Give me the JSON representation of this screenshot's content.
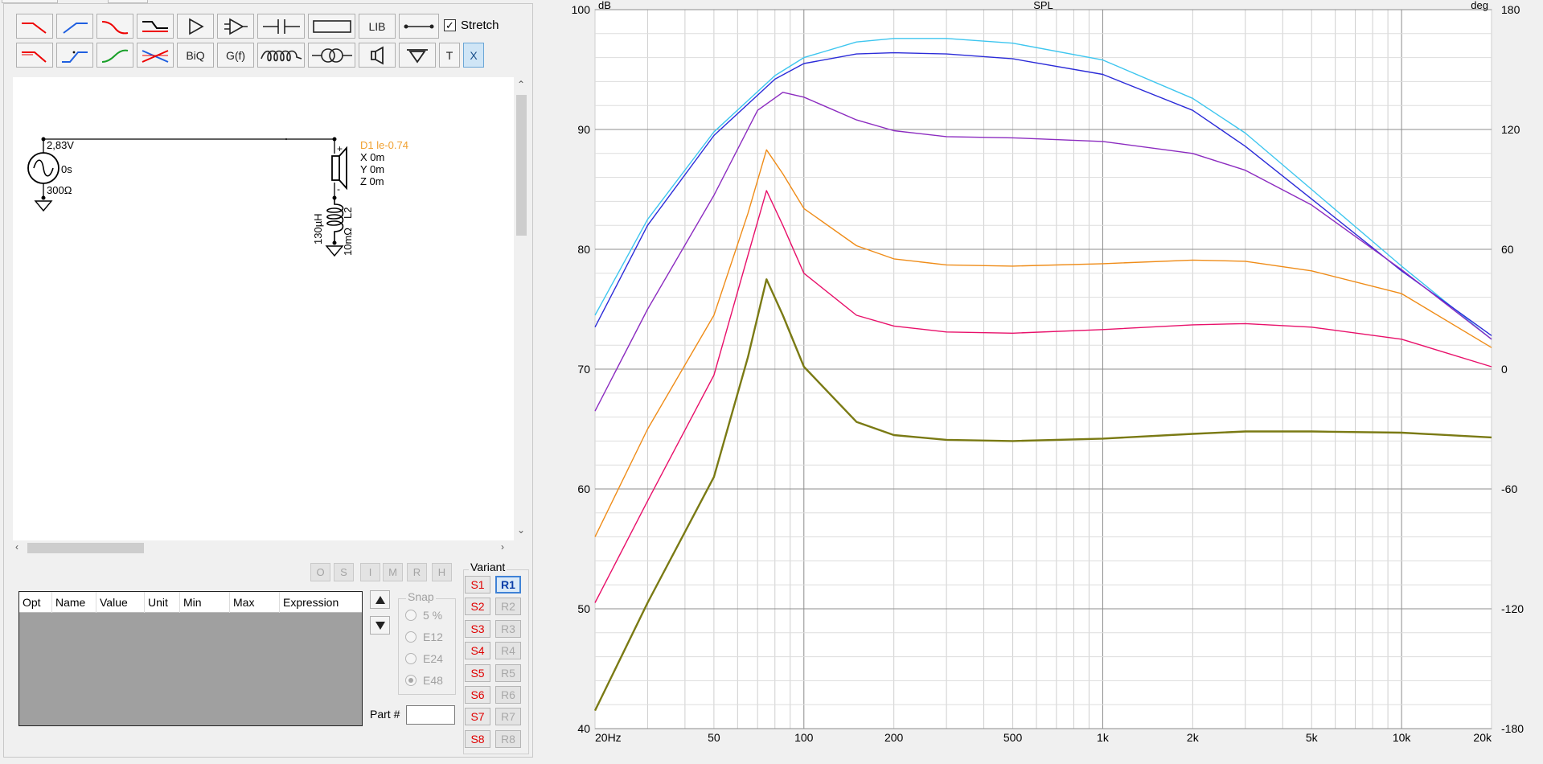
{
  "toolbar": {
    "row1_labels": [
      "LIB"
    ],
    "row2_labels": [
      "BiQ",
      "G(f)",
      "T",
      "X"
    ],
    "stretch_label": "Stretch",
    "stretch_checked": true,
    "icons_row1": [
      "lowpass-filter-icon",
      "highpass-filter-icon",
      "bandpass-filter-icon",
      "shelf-filter-icon",
      "buffer-amp-icon",
      "opamp-icon",
      "capacitor-icon",
      "resistor-icon",
      "lib-button",
      "wire-icon"
    ],
    "icons_row2": [
      "lowpass-2-icon",
      "highpass-2-icon",
      "allpass-icon",
      "crossover-icon",
      "biquad-button",
      "transfer-function-button",
      "inductor-icon",
      "transformer-icon",
      "speaker-icon",
      "ground-icon",
      "text-button",
      "x-button"
    ]
  },
  "schematic": {
    "source_voltage": "2,83V",
    "source_delay": "0s",
    "source_impedance": "300Ω",
    "driver_name": "D1 le-0.74",
    "driver_x": "X 0m",
    "driver_y": "Y 0m",
    "driver_z": "Z 0m",
    "inductor_value": "130µH",
    "inductor_resistance": "10mΩ",
    "inductor_name": "L2",
    "plus": "+",
    "minus": "-"
  },
  "opt_buttons": [
    "O",
    "S",
    "I",
    "M",
    "R",
    "H"
  ],
  "table": {
    "columns": [
      "Opt",
      "Name",
      "Value",
      "Unit",
      "Min",
      "Max",
      "Expression"
    ]
  },
  "snap": {
    "label": "Snap",
    "options": [
      "5 %",
      "E12",
      "E24",
      "E48"
    ],
    "selected": "E48"
  },
  "part_label": "Part #",
  "variant": {
    "label": "Variant",
    "s_buttons": [
      "S1",
      "S2",
      "S3",
      "S4",
      "S5",
      "S6",
      "S7",
      "S8"
    ],
    "r_buttons": [
      "R1",
      "R2",
      "R3",
      "R4",
      "R5",
      "R6",
      "R7",
      "R8"
    ],
    "active_r": "R1"
  },
  "chart_data": {
    "type": "line",
    "title": "SPL",
    "ylabel": "dB",
    "y2label": "deg",
    "xscale": "log",
    "xlim": [
      20,
      20000
    ],
    "ylim": [
      40,
      100
    ],
    "y2lim": [
      -180,
      180
    ],
    "x_ticks": [
      {
        "v": 20,
        "l": "20Hz"
      },
      {
        "v": 50,
        "l": "50"
      },
      {
        "v": 100,
        "l": "100"
      },
      {
        "v": 200,
        "l": "200"
      },
      {
        "v": 500,
        "l": "500"
      },
      {
        "v": 1000,
        "l": "1k"
      },
      {
        "v": 2000,
        "l": "2k"
      },
      {
        "v": 5000,
        "l": "5k"
      },
      {
        "v": 10000,
        "l": "10k"
      },
      {
        "v": 20000,
        "l": "20k"
      }
    ],
    "y_ticks": [
      40,
      50,
      60,
      70,
      80,
      90,
      100
    ],
    "y2_ticks": [
      -180,
      -120,
      -60,
      0,
      60,
      120,
      180
    ],
    "grid": true,
    "series": [
      {
        "color": "#3ec6ef",
        "points": [
          [
            20,
            74.5
          ],
          [
            30,
            82.5
          ],
          [
            50,
            89.8
          ],
          [
            80,
            94.5
          ],
          [
            100,
            96.0
          ],
          [
            150,
            97.3
          ],
          [
            200,
            97.6
          ],
          [
            300,
            97.6
          ],
          [
            500,
            97.2
          ],
          [
            1000,
            95.8
          ],
          [
            2000,
            92.6
          ],
          [
            3000,
            89.7
          ],
          [
            5000,
            85.0
          ],
          [
            10000,
            78.6
          ],
          [
            20000,
            72.5
          ]
        ]
      },
      {
        "color": "#2b2bd8",
        "points": [
          [
            20,
            73.5
          ],
          [
            30,
            82.0
          ],
          [
            50,
            89.5
          ],
          [
            80,
            94.2
          ],
          [
            100,
            95.5
          ],
          [
            150,
            96.3
          ],
          [
            200,
            96.4
          ],
          [
            300,
            96.3
          ],
          [
            500,
            95.9
          ],
          [
            1000,
            94.6
          ],
          [
            2000,
            91.6
          ],
          [
            3000,
            88.6
          ],
          [
            5000,
            84.2
          ],
          [
            10000,
            78.2
          ],
          [
            20000,
            72.8
          ]
        ]
      },
      {
        "color": "#8c2cc0",
        "points": [
          [
            20,
            66.5
          ],
          [
            30,
            75.0
          ],
          [
            50,
            84.5
          ],
          [
            70,
            91.6
          ],
          [
            85,
            93.1
          ],
          [
            100,
            92.7
          ],
          [
            150,
            90.8
          ],
          [
            200,
            89.9
          ],
          [
            300,
            89.4
          ],
          [
            500,
            89.3
          ],
          [
            1000,
            89.0
          ],
          [
            2000,
            88.0
          ],
          [
            3000,
            86.6
          ],
          [
            5000,
            83.7
          ],
          [
            10000,
            78.3
          ],
          [
            20000,
            72.5
          ]
        ]
      },
      {
        "color": "#ef8c18",
        "points": [
          [
            20,
            56.0
          ],
          [
            30,
            65.0
          ],
          [
            50,
            74.5
          ],
          [
            65,
            83.0
          ],
          [
            75,
            88.3
          ],
          [
            85,
            86.3
          ],
          [
            100,
            83.4
          ],
          [
            150,
            80.3
          ],
          [
            200,
            79.2
          ],
          [
            300,
            78.7
          ],
          [
            500,
            78.6
          ],
          [
            1000,
            78.8
          ],
          [
            2000,
            79.1
          ],
          [
            3000,
            79.0
          ],
          [
            5000,
            78.2
          ],
          [
            10000,
            76.3
          ],
          [
            20000,
            71.8
          ]
        ]
      },
      {
        "color": "#e8106a",
        "points": [
          [
            20,
            50.5
          ],
          [
            30,
            59.0
          ],
          [
            50,
            69.5
          ],
          [
            65,
            79.5
          ],
          [
            75,
            84.9
          ],
          [
            85,
            82.0
          ],
          [
            100,
            78.0
          ],
          [
            150,
            74.5
          ],
          [
            200,
            73.6
          ],
          [
            300,
            73.1
          ],
          [
            500,
            73.0
          ],
          [
            1000,
            73.3
          ],
          [
            2000,
            73.7
          ],
          [
            3000,
            73.8
          ],
          [
            5000,
            73.5
          ],
          [
            10000,
            72.5
          ],
          [
            20000,
            70.2
          ]
        ]
      },
      {
        "color": "#7a7a14",
        "width": 2.4,
        "points": [
          [
            20,
            41.5
          ],
          [
            30,
            50.5
          ],
          [
            50,
            61.0
          ],
          [
            65,
            71.0
          ],
          [
            75,
            77.5
          ],
          [
            85,
            74.5
          ],
          [
            100,
            70.2
          ],
          [
            150,
            65.6
          ],
          [
            200,
            64.5
          ],
          [
            300,
            64.1
          ],
          [
            500,
            64.0
          ],
          [
            1000,
            64.2
          ],
          [
            2000,
            64.6
          ],
          [
            3000,
            64.8
          ],
          [
            5000,
            64.8
          ],
          [
            10000,
            64.7
          ],
          [
            20000,
            64.3
          ]
        ]
      }
    ]
  }
}
